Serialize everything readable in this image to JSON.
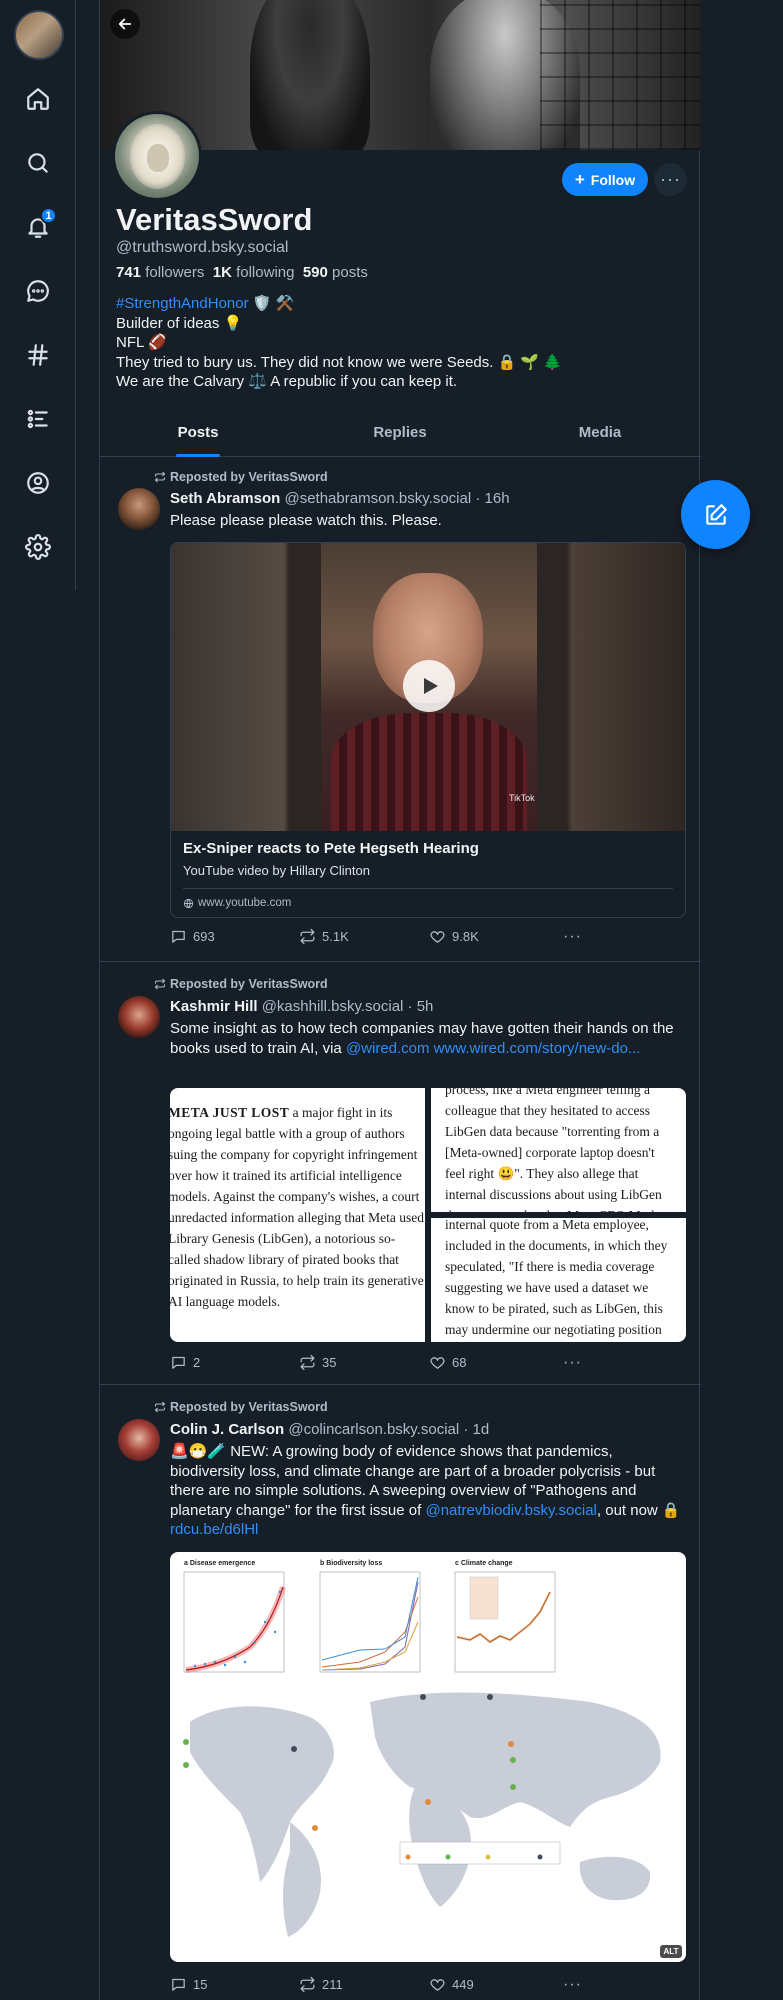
{
  "sidebar": {
    "notifications_badge": "1",
    "items": [
      {
        "name": "home-icon"
      },
      {
        "name": "search-icon"
      },
      {
        "name": "bell-icon"
      },
      {
        "name": "chat-icon"
      },
      {
        "name": "hashtag-icon"
      },
      {
        "name": "list-icon"
      },
      {
        "name": "profile-icon"
      },
      {
        "name": "gear-icon"
      }
    ]
  },
  "profile": {
    "display_name": "VeritasSword",
    "handle": "@truthsword.bsky.social",
    "followers_count": "741",
    "followers_label": "followers",
    "following_count": "1K",
    "following_label": "following",
    "posts_count": "590",
    "posts_label": "posts",
    "follow_label": "Follow",
    "more_label": "···",
    "bio": {
      "tag": "#StrengthAndHonor",
      "line1_rest": " 🛡️ ⚒️",
      "line2": "Builder of ideas 💡",
      "line3": "NFL 🏈",
      "line4": "They tried to bury us. They did not know we were Seeds. 🔒 🌱 🌲",
      "line5": "We are the Calvary ⚖️  A republic if you can keep it."
    }
  },
  "tabs": [
    {
      "label": "Posts",
      "active": true
    },
    {
      "label": "Replies",
      "active": false
    },
    {
      "label": "Media",
      "active": false
    }
  ],
  "posts": [
    {
      "repost_label": "Reposted by VeritasSword",
      "author": "Seth Abramson",
      "handle": "@sethabramson.bsky.social",
      "time": "· 16h",
      "text": "Please please please watch this. Please.",
      "card": {
        "title": "Ex-Sniper reacts to Pete Hegseth Hearing",
        "description": "YouTube video by Hillary Clinton",
        "domain": "www.youtube.com",
        "watermark": "TikTok"
      },
      "replies": "693",
      "reposts": "5.1K",
      "likes": "9.8K"
    },
    {
      "repost_label": "Reposted by VeritasSword",
      "author": "Kashmir Hill",
      "handle": "@kashhill.bsky.social",
      "time": "· 5h",
      "text": "Some insight as to how tech companies may have gotten their hands on the books used to train AI, via ",
      "link1": "@wired.com",
      "link2": " www.wired.com/story/new-do...",
      "images": {
        "left_caps": "META JUST LOST",
        "left_text": " a major fight in its ongoing legal battle with a group of authors suing the company for copyright infringement over how it trained its artificial intelligence models. Against the company's wishes, a court unredacted information alleging that Meta used Library Genesis (LibGen), a notorious so-called shadow library of pirated books that originated in Russia, to help train its generative AI language models.",
        "right_top_text": "process, like a Meta engineer telling a colleague that they hesitated to access LibGen data because \"torrenting from a [Meta-owned] corporate laptop doesn't feel right 😃\". They also allege that internal discussions about using LibGen data were escalated to Meta CEO Mark",
        "right_bottom_text": "internal quote from a Meta employee, included in the documents, in which they speculated, \"If there is media coverage suggesting we have used a dataset we know to be pirated, such as LibGen, this may undermine our negotiating position with regulators on these issues.\" Meta"
      },
      "replies": "2",
      "reposts": "35",
      "likes": "68"
    },
    {
      "repost_label": "Reposted by VeritasSword",
      "author": "Colin J. Carlson",
      "handle": "@colincarlson.bsky.social",
      "time": "· 1d",
      "text": "🚨😷🧪 NEW: A growing body of evidence shows that pandemics, biodiversity loss, and climate change are part of a broader polycrisis - but there are no simple solutions. A sweeping overview of \"Pathogens and planetary change\" for the first issue of ",
      "link1": "@natrevbiodiv.bsky.social",
      "text_after": ", out now 🔒 ",
      "link2": "rdcu.be/d6lHl",
      "figure": {
        "panel_a": "a  Disease emergence",
        "panel_b": "b  Biodiversity loss",
        "panel_c": "c  Climate change",
        "alt": "ALT"
      },
      "replies": "15",
      "reposts": "211",
      "likes": "449"
    }
  ],
  "colors": {
    "background": "#161e27",
    "accent": "#1083fe",
    "link": "#2f8ef7",
    "muted": "#aebbc9",
    "border": "#2e4052"
  }
}
